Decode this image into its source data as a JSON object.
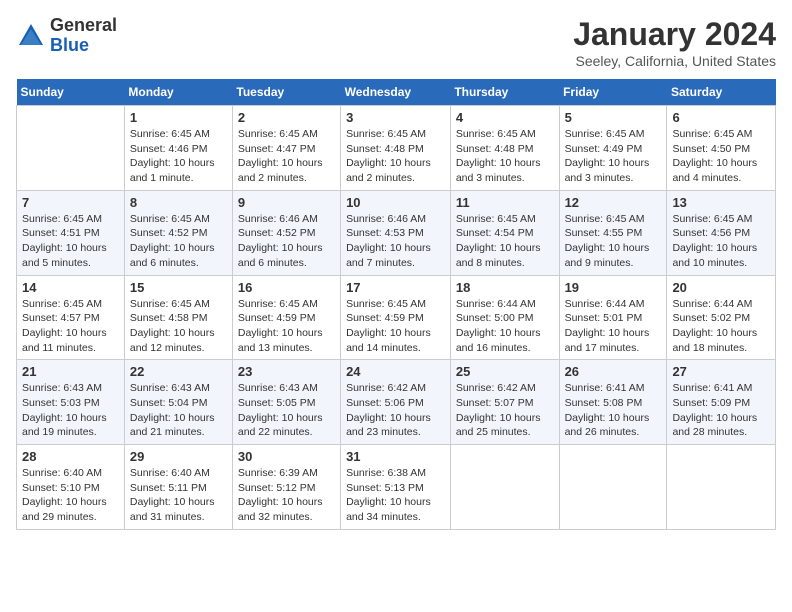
{
  "header": {
    "logo_general": "General",
    "logo_blue": "Blue",
    "month_year": "January 2024",
    "location": "Seeley, California, United States"
  },
  "days_of_week": [
    "Sunday",
    "Monday",
    "Tuesday",
    "Wednesday",
    "Thursday",
    "Friday",
    "Saturday"
  ],
  "weeks": [
    [
      {
        "day": "",
        "info": ""
      },
      {
        "day": "1",
        "info": "Sunrise: 6:45 AM\nSunset: 4:46 PM\nDaylight: 10 hours\nand 1 minute."
      },
      {
        "day": "2",
        "info": "Sunrise: 6:45 AM\nSunset: 4:47 PM\nDaylight: 10 hours\nand 2 minutes."
      },
      {
        "day": "3",
        "info": "Sunrise: 6:45 AM\nSunset: 4:48 PM\nDaylight: 10 hours\nand 2 minutes."
      },
      {
        "day": "4",
        "info": "Sunrise: 6:45 AM\nSunset: 4:48 PM\nDaylight: 10 hours\nand 3 minutes."
      },
      {
        "day": "5",
        "info": "Sunrise: 6:45 AM\nSunset: 4:49 PM\nDaylight: 10 hours\nand 3 minutes."
      },
      {
        "day": "6",
        "info": "Sunrise: 6:45 AM\nSunset: 4:50 PM\nDaylight: 10 hours\nand 4 minutes."
      }
    ],
    [
      {
        "day": "7",
        "info": "Sunrise: 6:45 AM\nSunset: 4:51 PM\nDaylight: 10 hours\nand 5 minutes."
      },
      {
        "day": "8",
        "info": "Sunrise: 6:45 AM\nSunset: 4:52 PM\nDaylight: 10 hours\nand 6 minutes."
      },
      {
        "day": "9",
        "info": "Sunrise: 6:46 AM\nSunset: 4:52 PM\nDaylight: 10 hours\nand 6 minutes."
      },
      {
        "day": "10",
        "info": "Sunrise: 6:46 AM\nSunset: 4:53 PM\nDaylight: 10 hours\nand 7 minutes."
      },
      {
        "day": "11",
        "info": "Sunrise: 6:45 AM\nSunset: 4:54 PM\nDaylight: 10 hours\nand 8 minutes."
      },
      {
        "day": "12",
        "info": "Sunrise: 6:45 AM\nSunset: 4:55 PM\nDaylight: 10 hours\nand 9 minutes."
      },
      {
        "day": "13",
        "info": "Sunrise: 6:45 AM\nSunset: 4:56 PM\nDaylight: 10 hours\nand 10 minutes."
      }
    ],
    [
      {
        "day": "14",
        "info": "Sunrise: 6:45 AM\nSunset: 4:57 PM\nDaylight: 10 hours\nand 11 minutes."
      },
      {
        "day": "15",
        "info": "Sunrise: 6:45 AM\nSunset: 4:58 PM\nDaylight: 10 hours\nand 12 minutes."
      },
      {
        "day": "16",
        "info": "Sunrise: 6:45 AM\nSunset: 4:59 PM\nDaylight: 10 hours\nand 13 minutes."
      },
      {
        "day": "17",
        "info": "Sunrise: 6:45 AM\nSunset: 4:59 PM\nDaylight: 10 hours\nand 14 minutes."
      },
      {
        "day": "18",
        "info": "Sunrise: 6:44 AM\nSunset: 5:00 PM\nDaylight: 10 hours\nand 16 minutes."
      },
      {
        "day": "19",
        "info": "Sunrise: 6:44 AM\nSunset: 5:01 PM\nDaylight: 10 hours\nand 17 minutes."
      },
      {
        "day": "20",
        "info": "Sunrise: 6:44 AM\nSunset: 5:02 PM\nDaylight: 10 hours\nand 18 minutes."
      }
    ],
    [
      {
        "day": "21",
        "info": "Sunrise: 6:43 AM\nSunset: 5:03 PM\nDaylight: 10 hours\nand 19 minutes."
      },
      {
        "day": "22",
        "info": "Sunrise: 6:43 AM\nSunset: 5:04 PM\nDaylight: 10 hours\nand 21 minutes."
      },
      {
        "day": "23",
        "info": "Sunrise: 6:43 AM\nSunset: 5:05 PM\nDaylight: 10 hours\nand 22 minutes."
      },
      {
        "day": "24",
        "info": "Sunrise: 6:42 AM\nSunset: 5:06 PM\nDaylight: 10 hours\nand 23 minutes."
      },
      {
        "day": "25",
        "info": "Sunrise: 6:42 AM\nSunset: 5:07 PM\nDaylight: 10 hours\nand 25 minutes."
      },
      {
        "day": "26",
        "info": "Sunrise: 6:41 AM\nSunset: 5:08 PM\nDaylight: 10 hours\nand 26 minutes."
      },
      {
        "day": "27",
        "info": "Sunrise: 6:41 AM\nSunset: 5:09 PM\nDaylight: 10 hours\nand 28 minutes."
      }
    ],
    [
      {
        "day": "28",
        "info": "Sunrise: 6:40 AM\nSunset: 5:10 PM\nDaylight: 10 hours\nand 29 minutes."
      },
      {
        "day": "29",
        "info": "Sunrise: 6:40 AM\nSunset: 5:11 PM\nDaylight: 10 hours\nand 31 minutes."
      },
      {
        "day": "30",
        "info": "Sunrise: 6:39 AM\nSunset: 5:12 PM\nDaylight: 10 hours\nand 32 minutes."
      },
      {
        "day": "31",
        "info": "Sunrise: 6:38 AM\nSunset: 5:13 PM\nDaylight: 10 hours\nand 34 minutes."
      },
      {
        "day": "",
        "info": ""
      },
      {
        "day": "",
        "info": ""
      },
      {
        "day": "",
        "info": ""
      }
    ]
  ]
}
